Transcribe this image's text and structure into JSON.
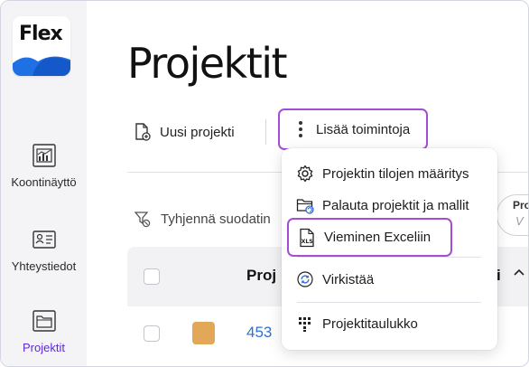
{
  "app": {
    "logo_text": "Flex",
    "brand_color": "#1f6fe5",
    "accent_color": "#a64dd6"
  },
  "sidebar": {
    "items": [
      {
        "label": "Koontinäyttö",
        "icon": "dashboard-chart-icon",
        "active": false
      },
      {
        "label": "Yhteystiedot",
        "icon": "contact-card-icon",
        "active": false
      },
      {
        "label": "Projektit",
        "icon": "projects-folder-icon",
        "active": true
      }
    ]
  },
  "page": {
    "title": "Projektit"
  },
  "toolbar": {
    "new_project_label": "Uusi projekti",
    "more_actions_label": "Lisää toimintoja",
    "clear_filters_label": "Tyhjennä suodatin"
  },
  "menu": {
    "items": [
      {
        "label": "Projektin tilojen määritys",
        "icon": "gear-icon"
      },
      {
        "label": "Palauta projektit ja mallit",
        "icon": "folder-restore-icon"
      },
      {
        "label": "Vieminen Exceliin",
        "icon": "xls-file-icon"
      },
      {
        "label": "Virkistää",
        "icon": "refresh-icon"
      },
      {
        "label": "Projektitaulukko",
        "icon": "grid-table-icon"
      }
    ]
  },
  "right_chip": {
    "line1": "Pro",
    "line2": "V"
  },
  "table": {
    "header_first": "Proj",
    "header_right": "i",
    "rows": [
      {
        "id": "453",
        "color": "#e3a857"
      }
    ]
  }
}
